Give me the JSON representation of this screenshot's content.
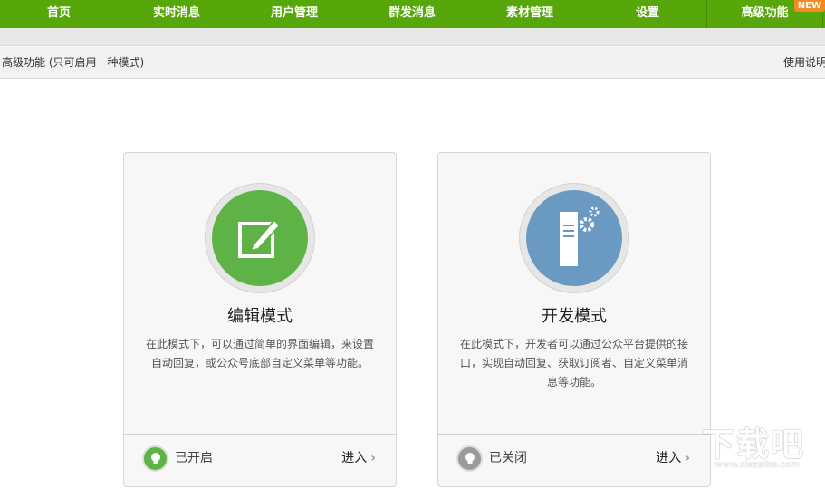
{
  "nav": {
    "items": [
      "首页",
      "实时消息",
      "用户管理",
      "群发消息",
      "素材管理",
      "设置",
      "高级功能"
    ],
    "new_badge": "NEW"
  },
  "bar": {
    "title": "高级功能 (只可启用一种模式)",
    "right": "使用说明"
  },
  "cards": [
    {
      "title": "编辑模式",
      "desc": "在此模式下，可以通过简单的界面编辑，来设置自动回复，或公众号底部自定义菜单等功能。",
      "status": "已开启",
      "enter": "进入",
      "color": "#5fb346"
    },
    {
      "title": "开发模式",
      "desc": "在此模式下，开发者可以通过公众平台提供的接口，实现自动回复、获取订阅者、自定义菜单消息等功能。",
      "status": "已关闭",
      "enter": "进入",
      "color": "#6a9ac2"
    }
  ],
  "watermark": {
    "logo": "下载吧",
    "url": "www.xiazaiba.com"
  }
}
